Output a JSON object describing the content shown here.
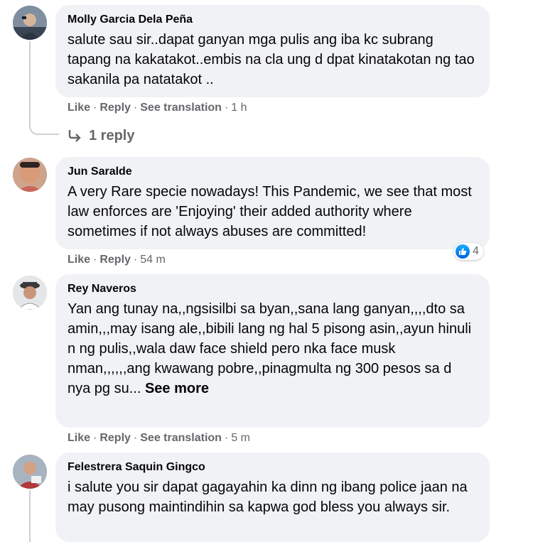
{
  "comments": [
    {
      "author": "Molly Garcia Dela Peña",
      "text": "salute sau sir..dapat ganyan mga pulis ang iba kc subrang tapang na kakatakot..embis na cla ung d dpat kinatakotan ng tao sakanila pa natatakot ..",
      "actions": {
        "like": "Like",
        "reply": "Reply",
        "translate": "See translation",
        "time": "1 h"
      },
      "replies_label": "1 reply"
    },
    {
      "author": "Jun Saralde",
      "text": "A very Rare specie nowadays! This Pandemic, we see that most law enforces are 'Enjoying' their added authority where sometimes if not always abuses are committed!",
      "actions": {
        "like": "Like",
        "reply": "Reply",
        "time": "54 m"
      },
      "reaction_count": "4"
    },
    {
      "author": "Rey Naveros",
      "text": "Yan ang tunay na,,ngsisilbi sa byan,,sana lang ganyan,,,,dto sa amin,,,may isang ale,,bibili lang ng hal 5 pisong asin,,ayun hinuli n ng pulis,,wala daw face shield pero nka face musk nman,,,,,,ang kwawang pobre,,pinagmulta ng 300 pesos sa d nya pg su...",
      "see_more": "See more",
      "actions": {
        "like": "Like",
        "reply": "Reply",
        "translate": "See translation",
        "time": "5 m"
      }
    },
    {
      "author": "Felestrera Saquin Gingco",
      "text": "i salute you sir dapat gagayahin ka dinn ng ibang police jaan na may pusong maintindihin sa kapwa god bless you always sir."
    }
  ],
  "separator": "·",
  "icons": {
    "reply_arrow": "reply-arrow-icon",
    "like_reaction": "thumbs-up-icon"
  },
  "colors": {
    "bubble": "#f0f2f5",
    "meta": "#65676b",
    "like_blue": "#1877f2"
  }
}
